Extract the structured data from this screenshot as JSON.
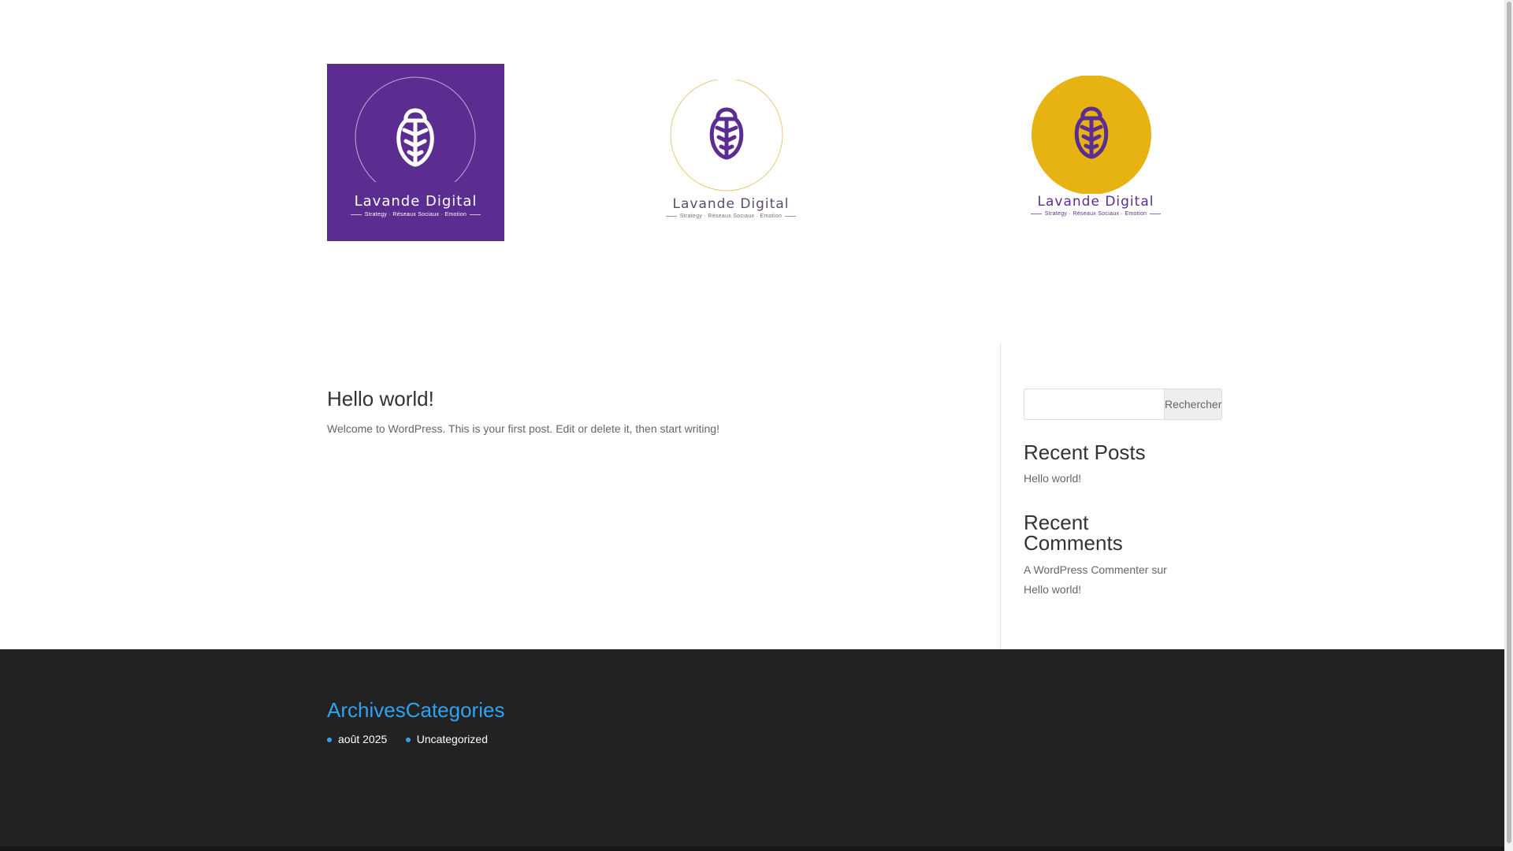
{
  "logos": [
    {
      "title": "Lavande Digital",
      "tagline": "Strategy · Réseaux Sociaux · Emotion",
      "bg": "#5c2d91",
      "circle": "#5c2d91",
      "insect": "#ffffff"
    },
    {
      "title": "Lavande Digital",
      "tagline": "Strategy · Réseaux Sociaux · Emotion",
      "bg": "#ffffff",
      "circle": "#ffffff",
      "insect": "#5c2d91"
    },
    {
      "title": "Lavande Digital",
      "tagline": "Strategy · Réseaux Sociaux · Emotion",
      "bg": "#ffffff",
      "circle": "#e6b312",
      "insect": "#5c2d91"
    }
  ],
  "post": {
    "title": "Hello world!",
    "excerpt": "Welcome to WordPress. This is your first post. Edit or delete it, then start writing!"
  },
  "sidebar": {
    "search": {
      "placeholder": "",
      "button_label": "Rechercher"
    },
    "recent_posts": {
      "title": "Recent Posts",
      "items": [
        "Hello world!"
      ]
    },
    "recent_comments": {
      "title": "Recent Comments",
      "author": "A WordPress Commenter",
      "connector": "sur",
      "post": "Hello world!"
    }
  },
  "footer": {
    "archives": {
      "title": "Archives",
      "items": [
        "août 2025"
      ]
    },
    "categories": {
      "title": "Categories",
      "items": [
        "Uncategorized"
      ]
    }
  },
  "colors": {
    "accent": "#2ea3f2",
    "footer_bg": "#222222",
    "brand_purple": "#5c2d91",
    "brand_gold": "#e6b312"
  }
}
